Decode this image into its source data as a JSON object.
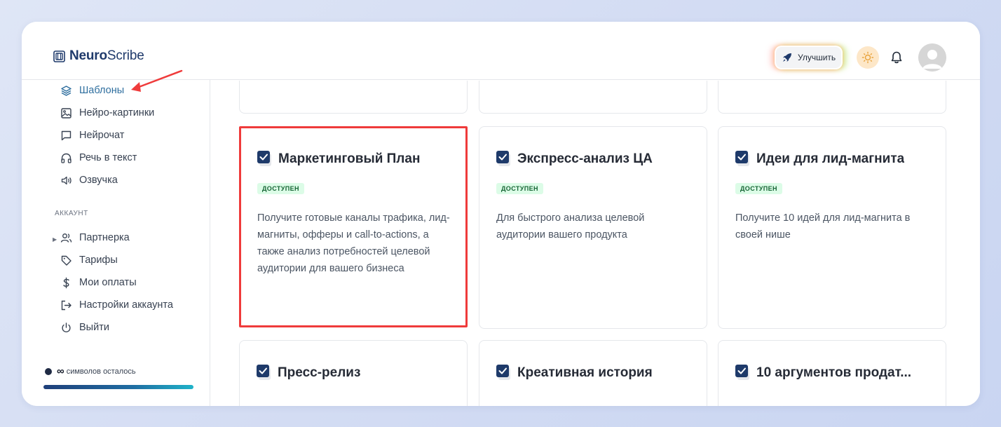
{
  "brand": {
    "name_bold": "Neuro",
    "name_rest": "Scribe"
  },
  "header": {
    "upgrade_label": "Улучшить"
  },
  "sidebar": {
    "items": [
      {
        "label": "Шаблоны",
        "icon": "layers-icon",
        "active": true
      },
      {
        "label": "Нейро-картинки",
        "icon": "image-icon"
      },
      {
        "label": "Нейрочат",
        "icon": "chat-icon"
      },
      {
        "label": "Речь в текст",
        "icon": "headphones-icon"
      },
      {
        "label": "Озвучка",
        "icon": "speaker-icon"
      }
    ],
    "account_section": "аккаунт",
    "account_items": [
      {
        "label": "Партнерка",
        "icon": "users-icon"
      },
      {
        "label": "Тарифы",
        "icon": "tag-icon"
      },
      {
        "label": "Мои оплаты",
        "icon": "dollar-icon"
      },
      {
        "label": "Настройки аккаунта",
        "icon": "logout-arrow-icon"
      },
      {
        "label": "Выйти",
        "icon": "power-icon"
      }
    ],
    "credits": {
      "symbol": "∞",
      "text": "символов осталось"
    }
  },
  "cards": [
    {
      "title": "Маркетинговый План",
      "badge": "доступен",
      "description": "Получите готовые каналы трафика, лид-магниты, офферы и call-to-actions, а также анализ потребностей целевой аудитории для вашего бизнеса"
    },
    {
      "title": "Экспресс-анализ ЦА",
      "badge": "доступен",
      "description": "Для быстрого анализа целевой аудитории вашего продукта"
    },
    {
      "title": "Идеи для лид-магнита",
      "badge": "доступен",
      "description": "Получите 10 идей для лид-магнита в своей нише"
    },
    {
      "title": "Пресс-релиз"
    },
    {
      "title": "Креативная история"
    },
    {
      "title": "10 аргументов продат..."
    }
  ],
  "colors": {
    "brand": "#1f3a6b",
    "active_nav": "#2f6f9f",
    "highlight": "#ef3b3b",
    "badge_bg": "#dcfce7",
    "badge_text": "#166534"
  }
}
